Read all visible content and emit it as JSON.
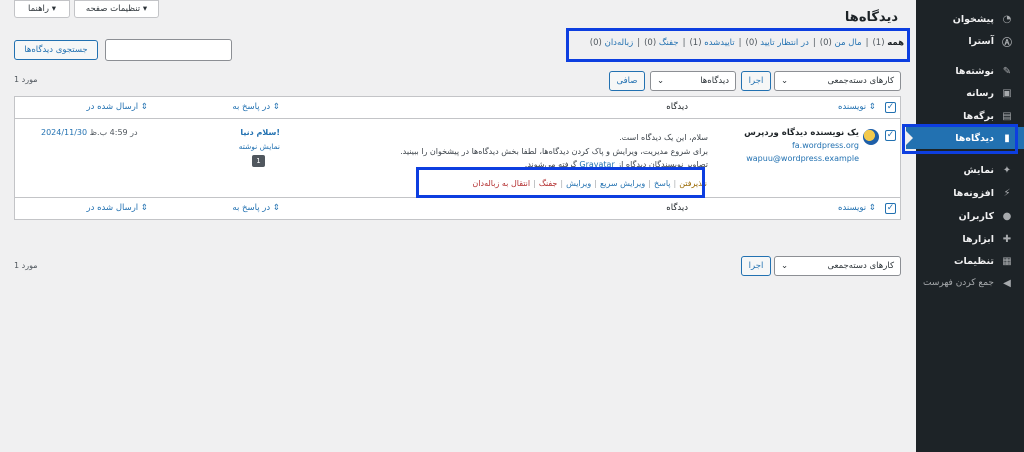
{
  "top_buttons": {
    "screen_options": "تنظیمات صفحه ▾",
    "help": "راهنما ▾"
  },
  "page_title": "دیدگاه‌ها",
  "filters": [
    {
      "label": "همه",
      "count": "(1)",
      "current": true
    },
    {
      "label": "مال من",
      "count": "(0)"
    },
    {
      "label": "در انتظار تایید",
      "count": "(0)"
    },
    {
      "label": "تاییدشده",
      "count": "(1)"
    },
    {
      "label": "جفنگ",
      "count": "(0)"
    },
    {
      "label": "زباله‌دان",
      "count": "(0)"
    }
  ],
  "search_button": "جستجوی دیدگاه‌ها",
  "bulk_top": {
    "select": "کارهای دسته‌جمعی",
    "apply": "اجرا",
    "type_select": "دیدگاه‌ها",
    "filter": "صافی"
  },
  "bulk_bottom": {
    "select": "کارهای دسته‌جمعی",
    "apply": "اجرا"
  },
  "items_count": "1 مورد",
  "columns": {
    "author": "نویسنده",
    "comment": "دیدگاه",
    "in_response_to": "در پاسخ به",
    "submitted_on": "ارسال شده در"
  },
  "comment": {
    "author_name": "یک نویسنده دیدگاه وردپرس",
    "author_url": "fa.wordpress.org",
    "author_email": "wapuu@wordpress.example",
    "text_1": "سلام، این یک دیدگاه است.",
    "text_2": "برای شروع مدیریت، ویرایش و پاک کردن دیدگاه‌ها، لطفا بخش دیدگاه‌ها در پیشخوان را ببینید.",
    "text_3_pre": "تصاویر نویسندگان دیدگاه از",
    "text_3_link": "Gravatar",
    "text_3_post": "گرفته می‌شوند.",
    "post_title": "سلام دنیا!",
    "view_post": "نمایش نوشته",
    "comment_count": "1",
    "date": "2024/11/30",
    "time_text": "در 4:59 ب.ظ",
    "actions": [
      {
        "label": "نپذیرفتن",
        "color": "#996800"
      },
      {
        "label": "پاسخ",
        "color": "#2271b1"
      },
      {
        "label": "ویرایش سریع",
        "color": "#2271b1"
      },
      {
        "label": "ویرایش",
        "color": "#2271b1"
      },
      {
        "label": "جفنگ",
        "color": "#b32d2e"
      },
      {
        "label": "انتقال به زباله‌دان",
        "color": "#b32d2e"
      }
    ]
  },
  "sidebar": {
    "items": [
      {
        "label": "پیشخوان",
        "icon": "dashboard-icon",
        "glyph": "◔"
      },
      {
        "label": "آسترا",
        "icon": "astra-icon",
        "glyph": "Ⓐ"
      },
      {
        "label": "نوشته‌ها",
        "icon": "pin-icon",
        "glyph": "✎"
      },
      {
        "label": "رسانه",
        "icon": "media-icon",
        "glyph": "▣"
      },
      {
        "label": "برگه‌ها",
        "icon": "pages-icon",
        "glyph": "▤"
      },
      {
        "label": "دیدگاه‌ها",
        "icon": "comments-icon",
        "glyph": "▮"
      },
      {
        "label": "نمایش",
        "icon": "appearance-icon",
        "glyph": "✦"
      },
      {
        "label": "افزونه‌ها",
        "icon": "plugins-icon",
        "glyph": "⚡"
      },
      {
        "label": "کاربران",
        "icon": "users-icon",
        "glyph": "●"
      },
      {
        "label": "ابزارها",
        "icon": "tools-icon",
        "glyph": "✚"
      },
      {
        "label": "تنظیمات",
        "icon": "settings-icon",
        "glyph": "▦"
      },
      {
        "label": "جمع کردن فهرست",
        "icon": "collapse-icon",
        "glyph": "◀"
      }
    ]
  },
  "colors": {
    "sidebar_bg": "#1d2327",
    "active": "#2271b1",
    "highlight": "#0d3ee0"
  }
}
